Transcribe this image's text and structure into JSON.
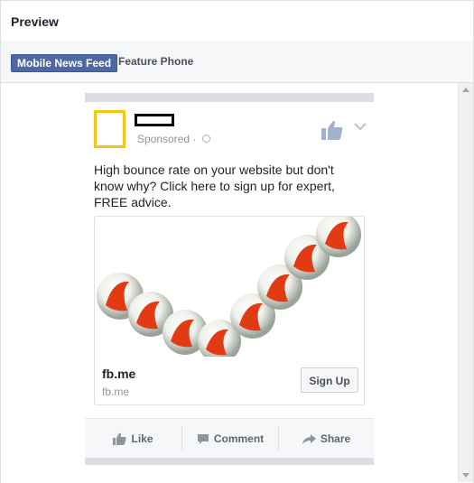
{
  "header": {
    "title": "Preview"
  },
  "tabs": [
    {
      "label": "Mobile News Feed",
      "active": true
    },
    {
      "label": "Feature Phone",
      "active": false
    }
  ],
  "post": {
    "sponsored_label": "Sponsored · ",
    "text": "High bounce rate on your website but don't know why? Click here to sign up for expert, FREE advice.",
    "link_title": "fb.me",
    "link_domain": "fb.me",
    "cta_label": "Sign Up",
    "actions": {
      "like": "Like",
      "comment": "Comment",
      "share": "Share"
    }
  },
  "colors": {
    "avatar_border": "#f7c614",
    "tab_active_bg": "#4e69a2",
    "marble_red": "#e23b14"
  },
  "icons": [
    "globe-icon",
    "thumbs-up-icon",
    "chevron-down-icon",
    "like-icon",
    "comment-icon",
    "share-icon"
  ]
}
